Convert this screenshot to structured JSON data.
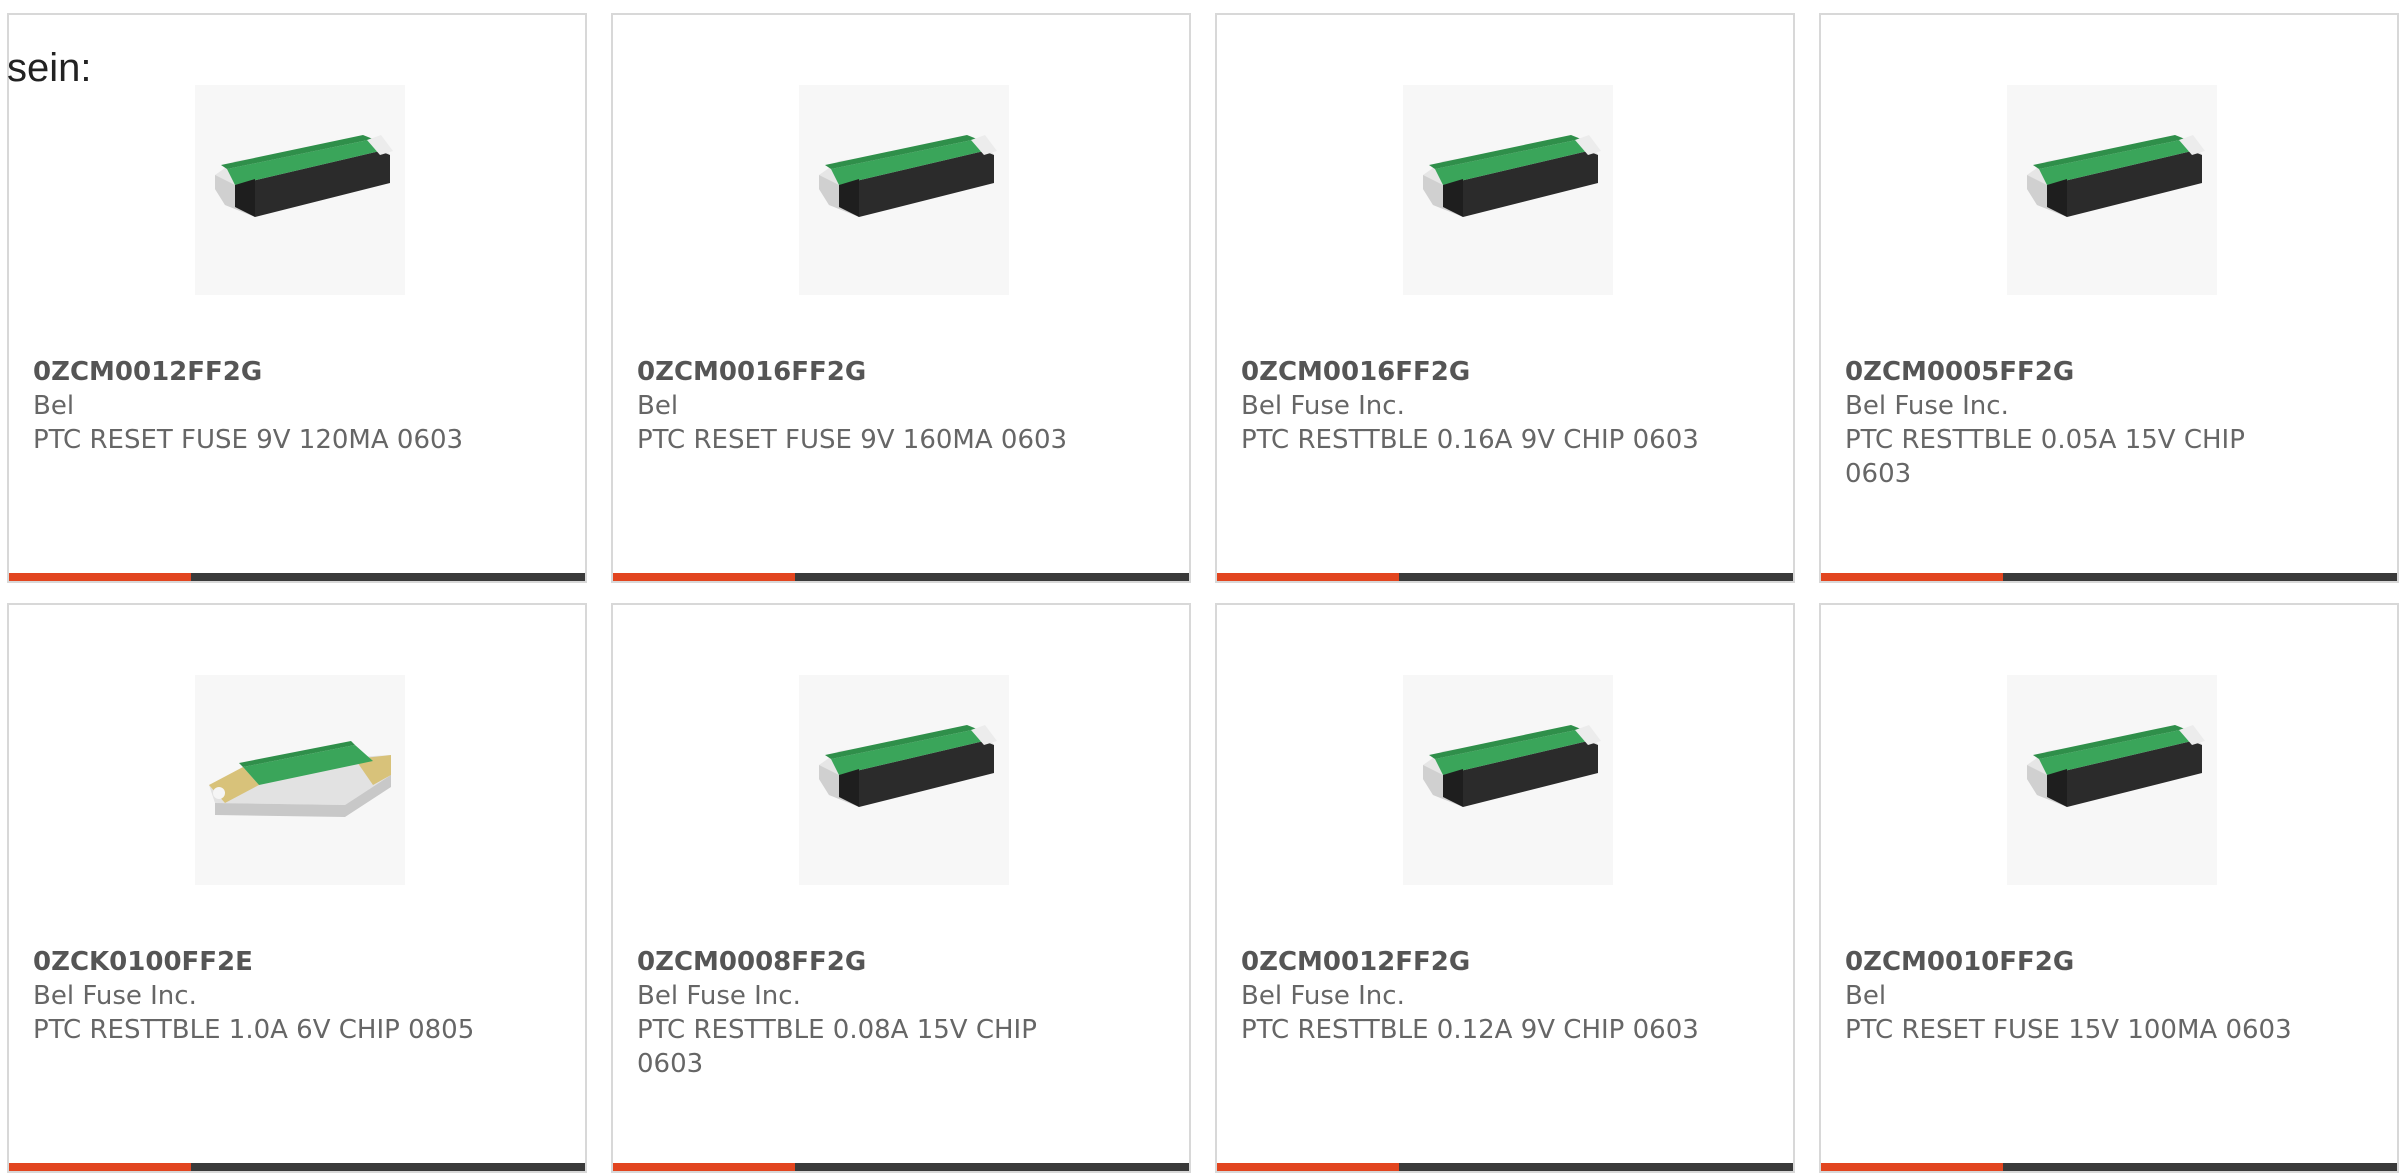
{
  "intro_text": "sein:",
  "colors": {
    "accent_bar": "#e2451f",
    "dark_bar": "#3a3a3a",
    "fuse_green": "#3aa55a",
    "fuse_body_dark": "#2b2b2b",
    "fuse_body_light": "#e9e9e9",
    "fuse_terminal_gold": "#d8c27a"
  },
  "products": [
    {
      "part": "0ZCM0012FF2G",
      "maker": "Bel",
      "desc": "PTC RESET FUSE 9V 120MA 0603",
      "image_icon": "smd-fuse-dark-icon"
    },
    {
      "part": "0ZCM0016FF2G",
      "maker": "Bel",
      "desc": "PTC RESET FUSE 9V 160MA 0603",
      "image_icon": "smd-fuse-dark-icon"
    },
    {
      "part": "0ZCM0016FF2G",
      "maker": "Bel Fuse Inc.",
      "desc": "PTC RESTTBLE 0.16A 9V CHIP 0603",
      "image_icon": "smd-fuse-dark-icon"
    },
    {
      "part": "0ZCM0005FF2G",
      "maker": "Bel Fuse Inc.",
      "desc": "PTC RESTTBLE 0.05A 15V CHIP 0603",
      "image_icon": "smd-fuse-dark-icon"
    },
    {
      "part": "0ZCK0100FF2E",
      "maker": "Bel Fuse Inc.",
      "desc": "PTC RESTTBLE 1.0A 6V CHIP 0805",
      "image_icon": "smd-fuse-gold-icon"
    },
    {
      "part": "0ZCM0008FF2G",
      "maker": "Bel Fuse Inc.",
      "desc": "PTC RESTTBLE 0.08A 15V CHIP 0603",
      "image_icon": "smd-fuse-dark-icon"
    },
    {
      "part": "0ZCM0012FF2G",
      "maker": "Bel Fuse Inc.",
      "desc": "PTC RESTTBLE 0.12A 9V CHIP 0603",
      "image_icon": "smd-fuse-dark-icon"
    },
    {
      "part": "0ZCM0010FF2G",
      "maker": "Bel",
      "desc": "PTC RESET FUSE 15V 100MA 0603",
      "image_icon": "smd-fuse-dark-icon"
    }
  ]
}
